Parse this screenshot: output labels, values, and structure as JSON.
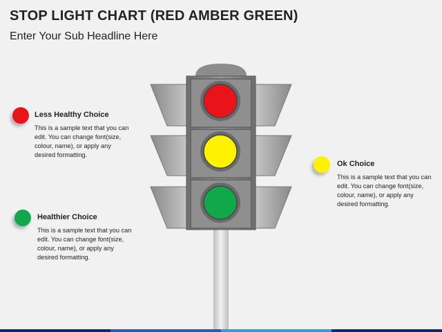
{
  "slide": {
    "title": "STOP LIGHT CHART (RED AMBER GREEN)",
    "subtitle": "Enter Your Sub Headline Here"
  },
  "callouts": [
    {
      "heading": "Less Healthy Choice",
      "body": "This is a sample text that you can edit. You can change font(size, colour, name), or apply any desired formatting.",
      "color": "#e8141a"
    },
    {
      "heading": "Healthier Choice",
      "body": "This is a sample text that you can edit. You can change font(size, colour, name), or apply any desired formatting.",
      "color": "#11a84b"
    },
    {
      "heading": "Ok Choice",
      "body": "This is a sample text that you can edit. You can change font(size, colour, name), or apply any desired formatting.",
      "color": "#fff200"
    }
  ],
  "traffic_light": {
    "lamps": [
      {
        "state": "red",
        "color": "#e8141a"
      },
      {
        "state": "amber",
        "color": "#fff200"
      },
      {
        "state": "green",
        "color": "#11a84b"
      }
    ],
    "housing_color": "#7a7a7a",
    "pole_color": "#d9d9d9"
  },
  "bottom_bar_colors": [
    "#0d2b6b",
    "#1f5fb5",
    "#2f9fd8",
    "#0d2b6b"
  ]
}
